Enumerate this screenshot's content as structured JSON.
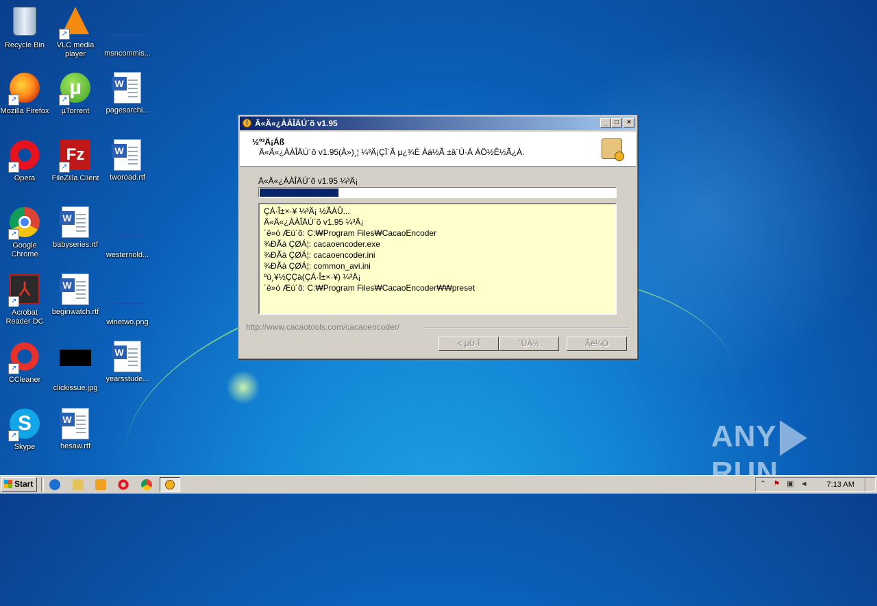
{
  "desktop": {
    "icons": [
      {
        "label": "Recycle Bin"
      },
      {
        "label": "VLC media player"
      },
      {
        "label": "msncommis..."
      },
      {
        "label": "Mozilla Firefox"
      },
      {
        "label": "µTorrent"
      },
      {
        "label": "pagesarchi..."
      },
      {
        "label": "Opera"
      },
      {
        "label": "FileZilla Client"
      },
      {
        "label": "tworoad.rtf"
      },
      {
        "label": "Google Chrome"
      },
      {
        "label": "babyseries.rtf"
      },
      {
        "label": "westernold..."
      },
      {
        "label": "Acrobat Reader DC"
      },
      {
        "label": "beginwatch.rtf"
      },
      {
        "label": "winetwo.png"
      },
      {
        "label": "CCleaner"
      },
      {
        "label": "clickissue.jpg"
      },
      {
        "label": "yearsstude..."
      },
      {
        "label": "Skype"
      },
      {
        "label": "hesaw.rtf"
      }
    ]
  },
  "window": {
    "title": "Ä«Ä«¿ÀÀÎÄÚ´õ v1.95",
    "header_title": "½º³Ä¡Áß",
    "header_subtitle": "Ä«Ä«¿ÀÀÎÄÚ´õ v1.95(À»)¸¦ ¼³Ä¡ÇÏ´Â µ¿¾È Àá½Ã ±â´Ù·Á ÁÖ½Ê½Ã¿À.",
    "status_text": "Ä«Ä«¿ÀÀÎÄÚ´õ v1.95 ¼³Ä¡",
    "progress": 0.22,
    "log_lines": [
      "ÇÁ·Î±×·¥ ¼³Ä¡ ½ÃÀÛ...",
      "Ä«Ä«¿ÀÀÎÄÚ´õ v1.95 ¼³Ä¡",
      "´ë»ó Æú´õ: C:₩Program Files₩CacaoEncoder",
      "¾ÐÃà ÇØÁ¦: cacaoencoder.exe",
      "¾ÐÃà ÇØÁ¦: cacaoencoder.ini",
      "¾ÐÃà ÇØÁ¦: common_avi.ini",
      "ºü¸¥½ÇÇà(ÇÁ·Î±×·¥) ¼³Ä¡",
      "´ë»ó Æú´õ: C:₩Program Files₩CacaoEncoder₩₩preset"
    ],
    "url": "http://www.cacaotools.com/cacaoencoder/",
    "buttons": {
      "back": "< µÚ·Î",
      "next": "´ÙÀ½",
      "cancel": "Ãë¼Ò"
    }
  },
  "watermark": {
    "left": "ANY",
    "right": "RUN"
  },
  "taskbar": {
    "start_label": "Start",
    "clock": "7:13 AM"
  },
  "colors": {
    "titlebar_start": "#0a246a",
    "titlebar_end": "#a6caf0",
    "log_bg": "#ffffcc",
    "progress_fill": "#0a246a"
  }
}
